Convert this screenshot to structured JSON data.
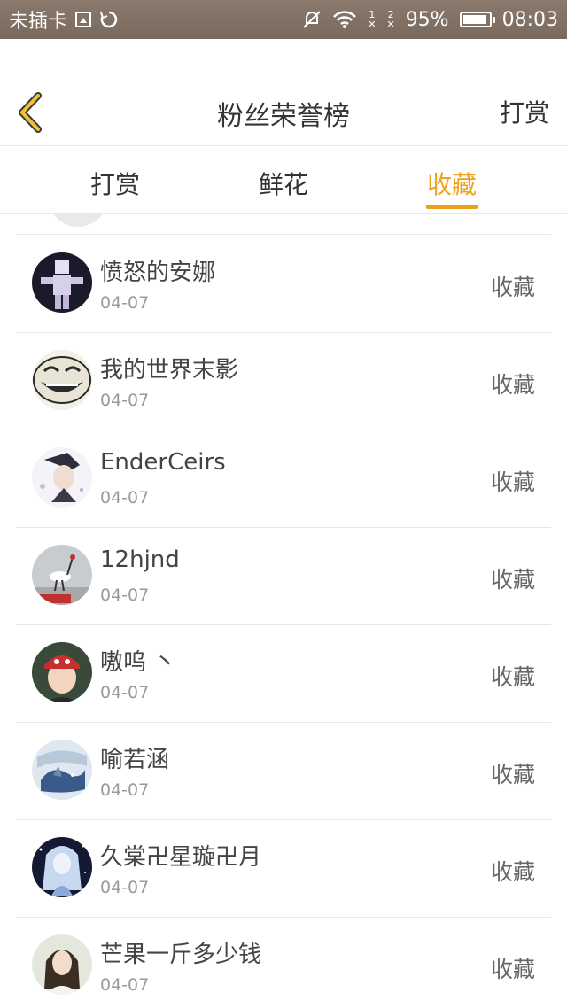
{
  "status_bar": {
    "carrier": "未插卡",
    "battery_percent": "95%",
    "battery_level": 0.95,
    "time": "08:03",
    "sim1": "1",
    "sim2": "2",
    "icons": [
      "sim-card-icon",
      "sync-icon",
      "mute-icon",
      "wifi-icon",
      "signal-icon",
      "battery-icon"
    ]
  },
  "nav": {
    "title": "粉丝荣誉榜",
    "action_label": "打赏",
    "back_icon": "chevron-left-icon",
    "accent_color": "#f0a01a"
  },
  "tabs": [
    {
      "label": "打赏",
      "active": false
    },
    {
      "label": "鲜花",
      "active": false
    },
    {
      "label": "收藏",
      "active": true
    }
  ],
  "rows": [
    {
      "name": "愤怒的安娜",
      "date": "04-07",
      "action": "收藏",
      "avatar_icon": "minecraft-character-avatar"
    },
    {
      "name": "我的世界末影",
      "date": "04-07",
      "action": "收藏",
      "avatar_icon": "troll-face-avatar"
    },
    {
      "name": "EnderCeirs",
      "date": "04-07",
      "action": "收藏",
      "avatar_icon": "anime-boy-avatar"
    },
    {
      "name": "12hjnd",
      "date": "04-07",
      "action": "收藏",
      "avatar_icon": "crane-avatar"
    },
    {
      "name": "嗷呜 丶",
      "date": "04-07",
      "action": "收藏",
      "avatar_icon": "girl-red-hat-avatar"
    },
    {
      "name": "喻若涵",
      "date": "04-07",
      "action": "收藏",
      "avatar_icon": "blue-dragon-avatar"
    },
    {
      "name": "久棠卍星璇卍月",
      "date": "04-07",
      "action": "收藏",
      "avatar_icon": "anime-girl-avatar"
    },
    {
      "name": "芒果一斤多少钱",
      "date": "04-07",
      "action": "收藏",
      "avatar_icon": "girl-portrait-avatar"
    }
  ]
}
